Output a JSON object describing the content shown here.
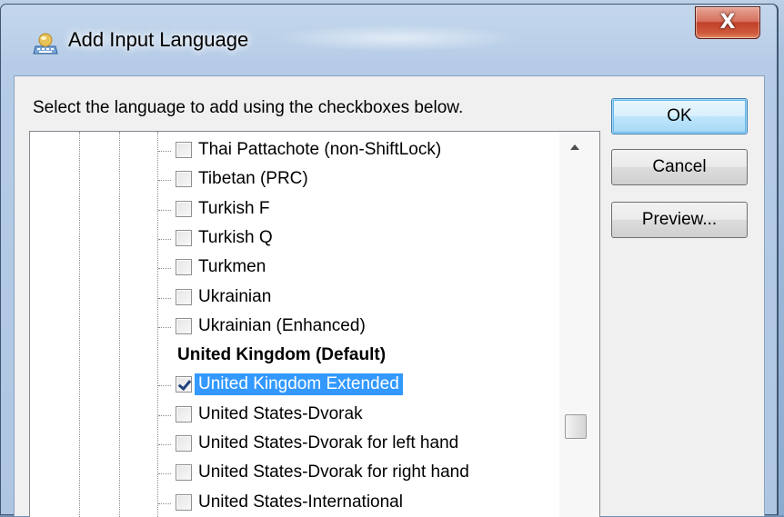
{
  "window": {
    "title": "Add Input Language",
    "close_glyph": "X"
  },
  "dialog": {
    "instruction": "Select the language to add using the checkboxes below."
  },
  "buttons": {
    "ok": "OK",
    "cancel": "Cancel",
    "preview": "Preview..."
  },
  "list": {
    "items": [
      {
        "label": "Thai Pattachote (non-ShiftLock)",
        "checked": false
      },
      {
        "label": "Tibetan (PRC)",
        "checked": false
      },
      {
        "label": "Turkish F",
        "checked": false
      },
      {
        "label": "Turkish Q",
        "checked": false
      },
      {
        "label": "Turkmen",
        "checked": false
      },
      {
        "label": "Ukrainian",
        "checked": false
      },
      {
        "label": "Ukrainian (Enhanced)",
        "checked": false
      },
      {
        "label": "United Kingdom (Default)",
        "checked": false,
        "bold": true
      },
      {
        "label": "United Kingdom Extended",
        "checked": true,
        "selected": true
      },
      {
        "label": "United States-Dvorak",
        "checked": false
      },
      {
        "label": "United States-Dvorak for left hand",
        "checked": false
      },
      {
        "label": "United States-Dvorak for right hand",
        "checked": false
      },
      {
        "label": "United States-International",
        "checked": false
      }
    ]
  },
  "colors": {
    "selection": "#3399ff",
    "close_button": "#c2402a"
  }
}
